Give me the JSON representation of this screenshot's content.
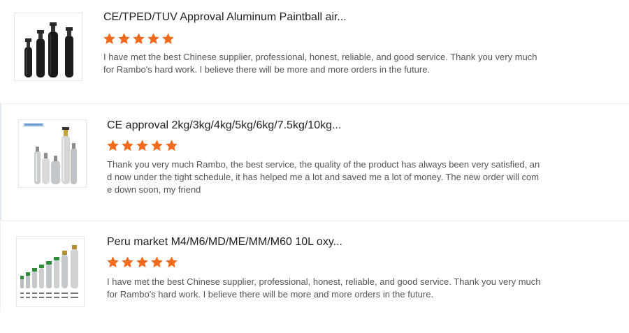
{
  "reviews": [
    {
      "title": "CE/TPED/TUV Approval Aluminum Paintball air...",
      "rating": 5,
      "text": "I have met the best Chinese supplier, professional, honest, reliable, and good service.  Thank you very much\nfor Rambo's hard work. I believe there will be more and more orders in the future.",
      "image_icon": "black-air-cylinders-icon"
    },
    {
      "title": "CE approval 2kg/3kg/4kg/5kg/6kg/7.5kg/10kg...",
      "rating": 5,
      "text": "Thank you very much Rambo, the best service, the quality of the product has always been very satisfied, an\nd now under the tight schedule, it has helped me a lot and saved me a lot of money. The new order will com\ne down soon, my friend",
      "image_icon": "silver-gas-cylinders-icon"
    },
    {
      "title": "Peru market M4/M6/MD/ME/MM/M60 10L oxy...",
      "rating": 5,
      "text": "I have met the best Chinese supplier, professional, honest, reliable, and good service.  Thank you very much\nfor Rambo's hard work. I believe there will be more and more orders in the future.",
      "image_icon": "oxygen-cylinders-lineup-icon"
    }
  ],
  "colors": {
    "star": "#f26b1d",
    "title": "#222222",
    "text": "#555555",
    "border": "#e6e6e6"
  }
}
